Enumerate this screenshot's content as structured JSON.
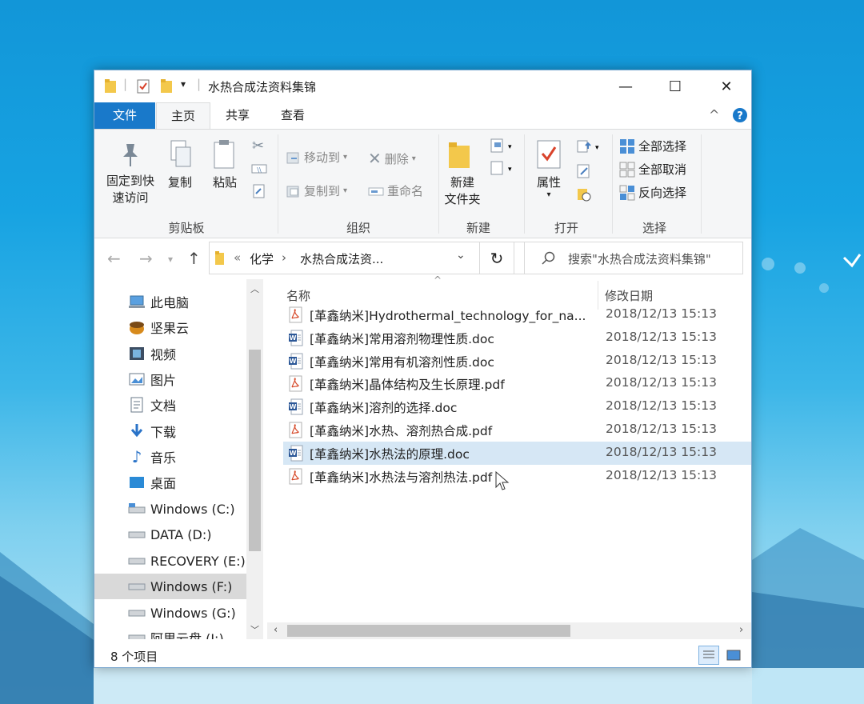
{
  "window": {
    "title": "水热合成法资料集锦",
    "minimize": "—",
    "maximize": "☐",
    "close": "✕"
  },
  "tabs": [
    {
      "label": "文件"
    },
    {
      "label": "主页"
    },
    {
      "label": "共享"
    },
    {
      "label": "查看"
    }
  ],
  "ribbon": {
    "pin_label_1": "固定到快",
    "pin_label_2": "速访问",
    "copy": "复制",
    "paste": "粘贴",
    "clipboard_group": "剪贴板",
    "move_to": "移动到",
    "copy_to": "复制到",
    "delete": "删除",
    "rename": "重命名",
    "organize_group": "组织",
    "new_folder_1": "新建",
    "new_folder_2": "文件夹",
    "new_group": "新建",
    "properties": "属性",
    "open_group": "打开",
    "select_all": "全部选择",
    "select_none": "全部取消",
    "invert_selection": "反向选择",
    "select_group": "选择"
  },
  "navbar": {
    "breadcrumb_root": "«",
    "crumb_1": "化学",
    "crumb_2": "水热合成法资...",
    "search_placeholder": "搜索\"水热合成法资料集锦\""
  },
  "nav_items": [
    {
      "label": "此电脑",
      "icon": "computer-icon"
    },
    {
      "label": "坚果云",
      "icon": "nutstore-icon"
    },
    {
      "label": "视频",
      "icon": "video-icon"
    },
    {
      "label": "图片",
      "icon": "pictures-icon"
    },
    {
      "label": "文档",
      "icon": "documents-icon"
    },
    {
      "label": "下载",
      "icon": "download-icon"
    },
    {
      "label": "音乐",
      "icon": "music-icon"
    },
    {
      "label": "桌面",
      "icon": "desktop-icon"
    },
    {
      "label": "Windows (C:)",
      "icon": "drive-icon"
    },
    {
      "label": "DATA (D:)",
      "icon": "drive-icon"
    },
    {
      "label": "RECOVERY (E:)",
      "icon": "drive-icon"
    },
    {
      "label": "Windows (F:)",
      "icon": "drive-icon",
      "selected": true
    },
    {
      "label": "Windows (G:)",
      "icon": "drive-icon"
    },
    {
      "label": "阿里云盘 (J:)",
      "icon": "drive-icon"
    }
  ],
  "columns": {
    "name": "名称",
    "date": "修改日期"
  },
  "files": [
    {
      "name": "[革鑫纳米]Hydrothermal_technology_for_na...",
      "date": "2018/12/13 15:13",
      "type": "pdf"
    },
    {
      "name": "[革鑫纳米]常用溶剂物理性质.doc",
      "date": "2018/12/13 15:13",
      "type": "doc"
    },
    {
      "name": "[革鑫纳米]常用有机溶剂性质.doc",
      "date": "2018/12/13 15:13",
      "type": "doc"
    },
    {
      "name": "[革鑫纳米]晶体结构及生长原理.pdf",
      "date": "2018/12/13 15:13",
      "type": "pdf"
    },
    {
      "name": "[革鑫纳米]溶剂的选择.doc",
      "date": "2018/12/13 15:13",
      "type": "doc"
    },
    {
      "name": "[革鑫纳米]水热、溶剂热合成.pdf",
      "date": "2018/12/13 15:13",
      "type": "pdf"
    },
    {
      "name": "[革鑫纳米]水热法的原理.doc",
      "date": "2018/12/13 15:13",
      "type": "doc",
      "selected": true
    },
    {
      "name": "[革鑫纳米]水热法与溶剂热法.pdf",
      "date": "2018/12/13 15:13",
      "type": "pdf"
    }
  ],
  "status": {
    "count": "8 个项目"
  }
}
